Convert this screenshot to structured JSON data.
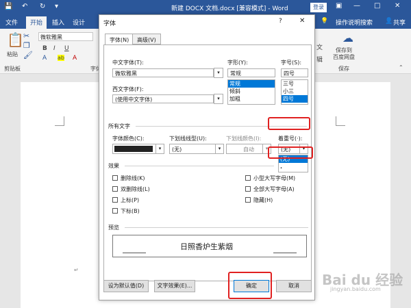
{
  "app": {
    "title": "新建 DOCX 文档.docx [兼容模式] - Word",
    "login": "登录",
    "tabs": [
      "文件",
      "开始",
      "插入",
      "设计"
    ],
    "active_tab": "开始",
    "tell_me": "操作说明搜索",
    "share": "共享",
    "colors": {
      "brand": "#2b579a",
      "red_mark": "#e02020"
    }
  },
  "ribbon": {
    "font_name": "微软雅黑",
    "paste_label": "粘贴",
    "clipboard_label": "剪贴板",
    "font_group_label": "字体",
    "save_to_baidu": [
      "保存到",
      "百度网盘"
    ],
    "save_group_label": "保存",
    "bold": "B",
    "italic": "I",
    "underline": "U",
    "highlight_glyph": "ab",
    "font_color_glyph": "A",
    "text_effect_glyph": "A",
    "partial_right": "文",
    "partial_right2": "辑"
  },
  "dialog": {
    "title": "字体",
    "help": "?",
    "close": "✕",
    "tabs": [
      "字体(N)",
      "高级(V)"
    ],
    "chinese_font_label": "中文字体(T):",
    "chinese_font_value": "微软雅黑",
    "western_font_label": "西文字体(F):",
    "western_font_value": "(使用中文字体)",
    "style_label": "字形(Y):",
    "style_value": "常规",
    "style_options": [
      "常规",
      "倾斜",
      "加粗"
    ],
    "style_selected": "常规",
    "size_label": "字号(S):",
    "size_value": "四号",
    "size_options": [
      "三号",
      "小三",
      "四号"
    ],
    "size_selected": "四号",
    "all_text_label": "所有文字",
    "font_color_label": "字体颜色(C):",
    "font_color_value": "#222222",
    "underline_style_label": "下划线线型(U):",
    "underline_style_value": "(无)",
    "underline_color_label": "下划线颜色(I):",
    "underline_color_value": "自动",
    "emphasis_label": "着重号(·):",
    "emphasis_value": "(无)",
    "emphasis_options": [
      "(无)",
      "."
    ],
    "effects_label": "效果",
    "effects_left": [
      "删除线(K)",
      "双删除线(L)",
      "上标(P)",
      "下标(B)"
    ],
    "effects_right": [
      "小型大写字母(M)",
      "全部大写字母(A)",
      "隐藏(H)"
    ],
    "preview_label": "预览",
    "preview_text": "日照香炉生紫烟",
    "buttons": {
      "set_default": "设为默认值(D)",
      "text_effects": "文字效果(E)...",
      "ok": "确定",
      "cancel": "取消"
    }
  },
  "watermark": {
    "text": "Bai du 经验",
    "sub": "jingyan.baidu.com"
  }
}
